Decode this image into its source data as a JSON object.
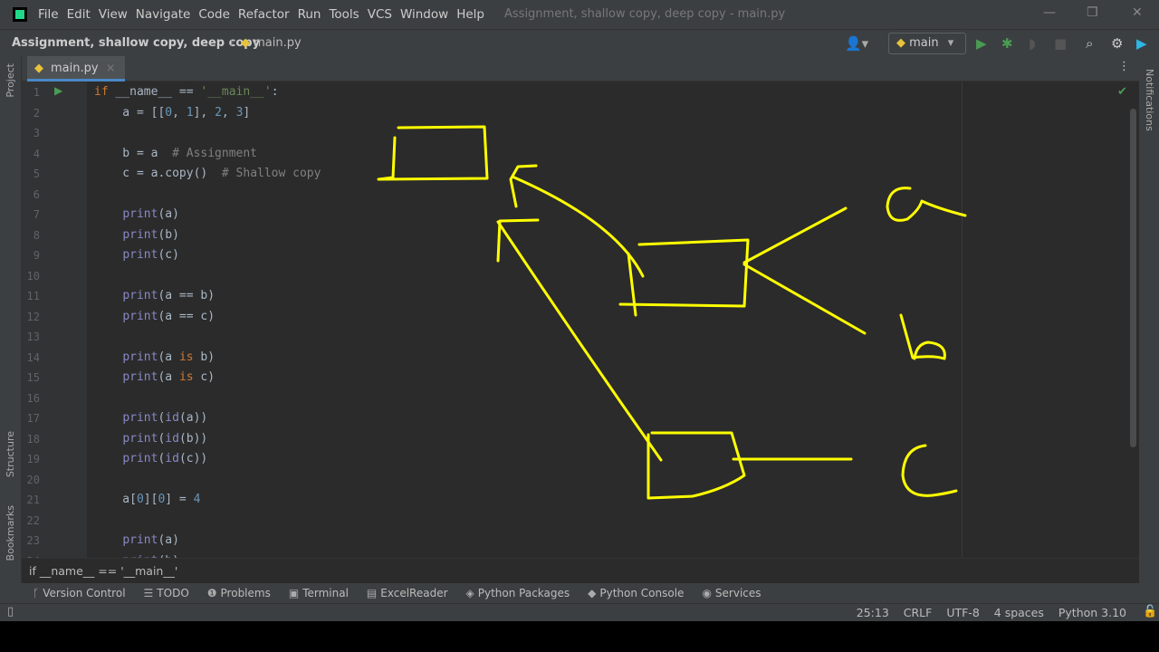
{
  "menu": [
    "File",
    "Edit",
    "View",
    "Navigate",
    "Code",
    "Refactor",
    "Run",
    "Tools",
    "VCS",
    "Window",
    "Help"
  ],
  "window_title": "Assignment, shallow copy, deep copy - main.py",
  "breadcrumb": {
    "project": "Assignment, shallow copy, deep copy",
    "file": "main.py"
  },
  "run_config": "main",
  "tab": "main.py",
  "side_left": [
    "Project",
    "Structure",
    "Bookmarks"
  ],
  "side_right": [
    "Notifications"
  ],
  "code": [
    [
      [
        "if",
        "kw"
      ],
      " __name__ == ",
      [
        "'__main__'",
        "str"
      ],
      ":"
    ],
    [
      "    a = [[",
      [
        "0",
        "num"
      ],
      ", ",
      [
        "1",
        "num"
      ],
      "], ",
      [
        "2",
        "num"
      ],
      ", ",
      [
        "3",
        "num"
      ],
      "]"
    ],
    [
      ""
    ],
    [
      "    b = a  ",
      [
        "# Assignment",
        "cm"
      ]
    ],
    [
      "    c = a.copy()  ",
      [
        "# Shallow copy",
        "cm"
      ]
    ],
    [
      ""
    ],
    [
      "    ",
      [
        "print",
        "fn"
      ],
      "(a)"
    ],
    [
      "    ",
      [
        "print",
        "fn"
      ],
      "(b)"
    ],
    [
      "    ",
      [
        "print",
        "fn"
      ],
      "(c)"
    ],
    [
      ""
    ],
    [
      "    ",
      [
        "print",
        "fn"
      ],
      "(a == b)"
    ],
    [
      "    ",
      [
        "print",
        "fn"
      ],
      "(a == c)"
    ],
    [
      ""
    ],
    [
      "    ",
      [
        "print",
        "fn"
      ],
      "(a ",
      [
        "is",
        "kw"
      ],
      " b)"
    ],
    [
      "    ",
      [
        "print",
        "fn"
      ],
      "(a ",
      [
        "is",
        "kw"
      ],
      " c)"
    ],
    [
      ""
    ],
    [
      "    ",
      [
        "print",
        "fn"
      ],
      "(",
      [
        "id",
        "fn"
      ],
      "(a))"
    ],
    [
      "    ",
      [
        "print",
        "fn"
      ],
      "(",
      [
        "id",
        "fn"
      ],
      "(b))"
    ],
    [
      "    ",
      [
        "print",
        "fn"
      ],
      "(",
      [
        "id",
        "fn"
      ],
      "(c))"
    ],
    [
      ""
    ],
    [
      "    a[",
      [
        "0",
        "num"
      ],
      "][",
      [
        "0",
        "num"
      ],
      "] = ",
      [
        "4",
        "num"
      ]
    ],
    [
      ""
    ],
    [
      "    ",
      [
        "print",
        "fn"
      ],
      "(a)"
    ],
    [
      "    ",
      [
        "print",
        "fn"
      ],
      "(b)"
    ]
  ],
  "hint": "if __name__ == '__main__'",
  "tool_windows": [
    {
      "icon": "branch-icon",
      "label": "Version Control"
    },
    {
      "icon": "list-icon",
      "label": "TODO"
    },
    {
      "icon": "problems-icon",
      "label": "Problems"
    },
    {
      "icon": "terminal-icon",
      "label": "Terminal"
    },
    {
      "icon": "excel-icon",
      "label": "ExcelReader"
    },
    {
      "icon": "layers-icon",
      "label": "Python Packages"
    },
    {
      "icon": "python-icon",
      "label": "Python Console"
    },
    {
      "icon": "services-icon",
      "label": "Services"
    }
  ],
  "status": {
    "position": "25:13",
    "line_sep": "CRLF",
    "encoding": "UTF-8",
    "indent": "4 spaces",
    "interpreter": "Python 3.10"
  },
  "colors": {
    "sketch": "#ffff00",
    "accent": "#4a88c7",
    "run": "#499c54"
  }
}
